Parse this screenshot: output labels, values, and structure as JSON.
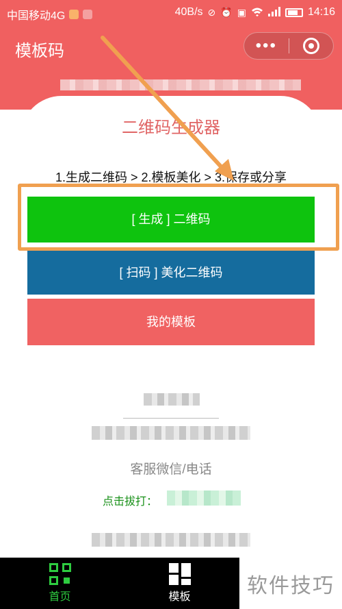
{
  "status_bar": {
    "carrier": "中国移动4G",
    "speed": "40B/s",
    "time": "14:16",
    "icons": [
      "sim-icon",
      "mute-icon",
      "alarm-icon",
      "hd-icon",
      "wifi-icon",
      "signal-icon",
      "battery-icon"
    ]
  },
  "nav": {
    "title": "模板码",
    "more_label": "•••",
    "close_icon": "record-icon"
  },
  "main": {
    "title": "二维码生成器",
    "steps": "1.生成二维码 > 2.模板美化 > 3.保存或分享",
    "buttons": {
      "generate": "[ 生成 ] 二维码",
      "scan": "[ 扫码 ] 美化二维码",
      "templates": "我的模板"
    },
    "colors": {
      "primary": "#f06060",
      "generate": "#0ec30e",
      "scan": "#156c9e",
      "highlight": "#f0a050"
    }
  },
  "footer": {
    "service": "客服微信/电话",
    "call_label": "点击拔打："
  },
  "tabbar": {
    "tabs": [
      {
        "label": "首页",
        "icon": "qr-code-icon",
        "active": true
      },
      {
        "label": "模板",
        "icon": "template-grid-icon",
        "active": false
      }
    ]
  },
  "watermark": "软件技巧"
}
